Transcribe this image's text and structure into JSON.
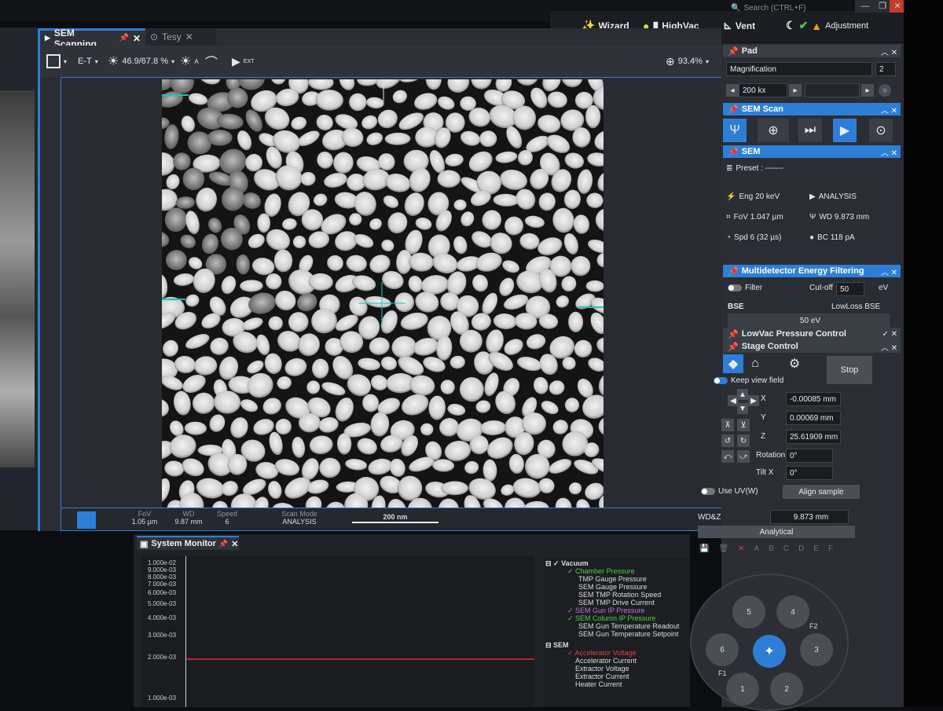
{
  "window_controls": {
    "search_placeholder": "Search (CTRL+F)",
    "minimize": "—",
    "maximize": "❐",
    "close": "✕"
  },
  "topbar": {
    "wizard": "Wizard",
    "highvac": "HighVac",
    "vent": "Vent",
    "adjustment": "Adjustment"
  },
  "tabs": [
    {
      "label": "SEM Scanning"
    },
    {
      "label": "Tesy"
    }
  ],
  "toolbar": {
    "detector": "E-T",
    "brightness_contrast": "46.9/67.8 %",
    "zoom": "93.4%",
    "ext_label": "EXT"
  },
  "status": {
    "fov": {
      "label": "FoV",
      "value": "1.05 µm"
    },
    "wd": {
      "label": "WD",
      "value": "9.87 mm"
    },
    "speed": {
      "label": "Speed",
      "value": "6"
    },
    "scan_mode": {
      "label": "Scan Mode",
      "value": "ANALYSIS"
    },
    "scalebar": "200 nm"
  },
  "pad": {
    "title": "Pad",
    "magnification_label": "Magnification",
    "magnification_value": "200 kx",
    "mag_step": "2"
  },
  "sem_scan": {
    "title": "SEM Scan"
  },
  "sem": {
    "title": "SEM",
    "preset": "Preset : -------",
    "eng": "Eng 20 keV",
    "mode": "ANALYSIS",
    "fov": "FoV 1.047 µm",
    "wd": "WD 9.873 mm",
    "spd": "Spd 6 (32 µs)",
    "bc": "BC 118 pA"
  },
  "mef": {
    "title": "Multidetector Energy Filtering",
    "filter": "Filter",
    "cutoff_label": "Cut-off",
    "cutoff_value": "50",
    "cutoff_unit": "eV",
    "bse": "BSE",
    "lowloss": "LowLoss BSE",
    "bar_value": "50 eV"
  },
  "lowvac": {
    "title": "LowVac Pressure Control"
  },
  "stage": {
    "title": "Stage Control",
    "stop": "Stop",
    "keep_view": "Keep view field",
    "x_label": "X",
    "x_value": "-0.00085 mm",
    "y_label": "Y",
    "y_value": "0.00069 mm",
    "z_label": "Z",
    "z_value": "25.61909 mm",
    "rotation_label": "Rotation",
    "rotation_value": "0°",
    "tilt_label": "Tilt X",
    "tilt_value": "0°",
    "use_uv": "Use UV(W)",
    "align": "Align sample",
    "wdz_label": "WD&Z",
    "wdz_value": "9.873 mm",
    "analytical": "Analytical",
    "letters": [
      "A",
      "B",
      "C",
      "D",
      "E",
      "F"
    ]
  },
  "wheel": {
    "positions": [
      "5",
      "4",
      "6",
      "3",
      "1",
      "2"
    ],
    "f1": "F1",
    "f2": "F2"
  },
  "sysmon": {
    "title": "System Monitor",
    "yticks": [
      "1.000e-02",
      "9.000e-03",
      "8.000e-03",
      "7.000e-03",
      "6.000e-03",
      "5.000e-03",
      "4.000e-03",
      "3.000e-03",
      "2.000e-03",
      "1.000e-03"
    ],
    "vacuum": "Vacuum",
    "vac_items": [
      "Chamber Pressure",
      "TMP Gauge Pressure",
      "SEM Gauge Pressure",
      "SEM TMP Rotation Speed",
      "SEM TMP Drive Current",
      "SEM Gun IP Pressure",
      "SEM Column IP Pressure",
      "SEM Gun Temperature Readout",
      "SEM Gun Temperature Setpoint"
    ],
    "sem": "SEM",
    "sem_items": [
      "Accelerator Voltage",
      "Accelerator Current",
      "Extractor Voltage",
      "Extractor Current",
      "Heater Current"
    ]
  },
  "colors": {
    "accent": "#2d7fd6",
    "panel": "#2a2d33",
    "trace": "#c0202a"
  }
}
